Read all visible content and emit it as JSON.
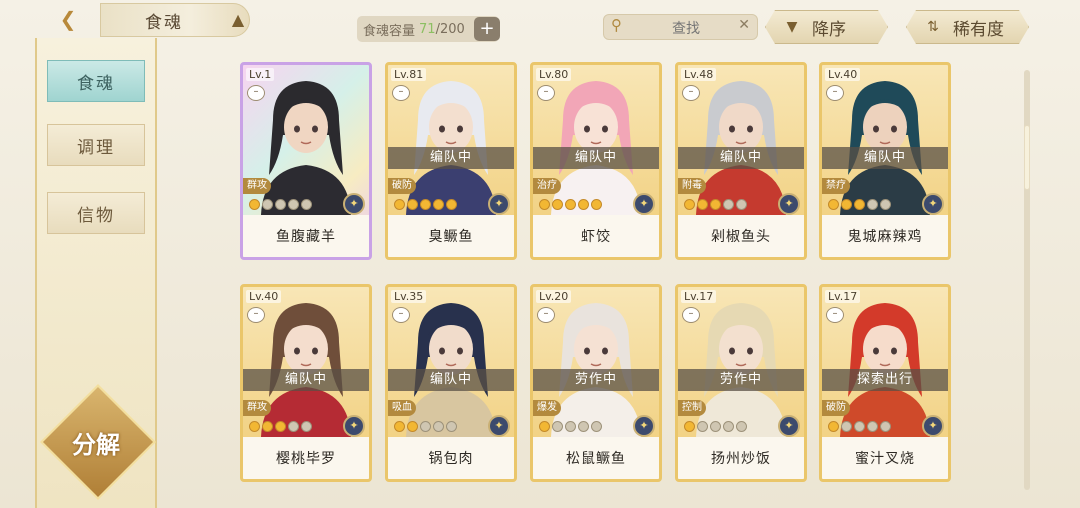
{
  "topbar": {
    "title": "食魂",
    "capacity_label": "食魂容量",
    "capacity_current": "71",
    "capacity_max": "/200",
    "search_placeholder": "查找",
    "sort_order": "降序",
    "sort_key": "稀有度"
  },
  "left_tabs": [
    {
      "label": "食魂",
      "active": true
    },
    {
      "label": "调理",
      "active": false
    },
    {
      "label": "信物",
      "active": false
    }
  ],
  "decompose_label": "分解",
  "colors": {
    "accent_gold": "#eac66a",
    "active_tab": "#9fd4d0",
    "capacity_current": "#8cbf62"
  },
  "cards": [
    {
      "level": "Lv.1",
      "status": "",
      "role": "群攻",
      "stars_on": 1,
      "name": "鱼腹藏羊",
      "rainbow": true,
      "hair": "#2b2a2e",
      "skin": "#f0d6c2",
      "outfit": "#2c2b31"
    },
    {
      "level": "Lv.81",
      "status": "编队中",
      "role": "破防",
      "stars_on": 5,
      "name": "臭鳜鱼",
      "rainbow": false,
      "hair": "#e8eaf0",
      "skin": "#f3dfcf",
      "outfit": "#3b3f70"
    },
    {
      "level": "Lv.80",
      "status": "编队中",
      "role": "治疗",
      "stars_on": 5,
      "name": "虾饺",
      "rainbow": false,
      "hair": "#f2a6b7",
      "skin": "#f8e2d6",
      "outfit": "#f7f1f1"
    },
    {
      "level": "Lv.48",
      "status": "编队中",
      "role": "附毒",
      "stars_on": 3,
      "name": "剁椒鱼头",
      "rainbow": false,
      "hair": "#c9cbcf",
      "skin": "#f0d9c8",
      "outfit": "#c53a2f"
    },
    {
      "level": "Lv.40",
      "status": "编队中",
      "role": "禁疗",
      "stars_on": 3,
      "name": "鬼城麻辣鸡",
      "rainbow": false,
      "hair": "#1f4a59",
      "skin": "#edd2bd",
      "outfit": "#2b3c46"
    },
    {
      "level": "Lv.40",
      "status": "编队中",
      "role": "群攻",
      "stars_on": 3,
      "name": "樱桃毕罗",
      "rainbow": false,
      "hair": "#6f4e3a",
      "skin": "#f4ddcd",
      "outfit": "#b52b34"
    },
    {
      "level": "Lv.35",
      "status": "编队中",
      "role": "吸血",
      "stars_on": 2,
      "name": "锅包肉",
      "rainbow": false,
      "hair": "#28314d",
      "skin": "#f1dccb",
      "outfit": "#d8c6a0"
    },
    {
      "level": "Lv.20",
      "status": "劳作中",
      "role": "爆发",
      "stars_on": 1,
      "name": "松鼠鳜鱼",
      "rainbow": false,
      "hair": "#e9e3dd",
      "skin": "#f5e1d3",
      "outfit": "#f4efe9"
    },
    {
      "level": "Lv.17",
      "status": "劳作中",
      "role": "控制",
      "stars_on": 1,
      "name": "扬州炒饭",
      "rainbow": false,
      "hair": "#e6d9b3",
      "skin": "#f3e0cf",
      "outfit": "#efe8d8"
    },
    {
      "level": "Lv.17",
      "status": "探索出行",
      "role": "破防",
      "stars_on": 1,
      "name": "蜜汁叉烧",
      "rainbow": false,
      "hair": "#d33a2a",
      "skin": "#f6dccb",
      "outfit": "#cf4a2a"
    }
  ]
}
